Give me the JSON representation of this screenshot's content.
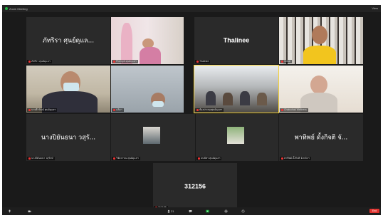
{
  "window": {
    "title": "Zoom Meeting",
    "view_label": "View"
  },
  "tiles": [
    {
      "name": "ภัทริรา ศุนย์ดุแล...",
      "label": "ภัทริรา ศุนย์ดุแลฯ"
    },
    {
      "name": "",
      "label": "Ploenpit ศุนย์ดุแลฯ"
    },
    {
      "name": "Thalinee",
      "label": "Thalinee"
    },
    {
      "name": "",
      "label": "Sebal"
    },
    {
      "name": "",
      "label": "นายธีรวัฒน์ ศุนย์ดุแลฯ"
    },
    {
      "name": "",
      "label": "ฉลิดา"
    },
    {
      "name": "",
      "label": "ห้องประชุมศุนย์ดุแลฯ"
    },
    {
      "name": "",
      "label": "Chatuchak Wellness"
    },
    {
      "name": "นางปิยันธนา วสุรั...",
      "label": "นางปิยันธนา วสุรักษ์"
    },
    {
      "name": "",
      "label": "วิชัยวรรณ ศุนย์ดุแลฯ"
    },
    {
      "name": "",
      "label": "ธนพัชร ศุนย์ดุแลฯ"
    },
    {
      "name": "พาทิพย์ ดั้งกิจติ จั...",
      "label": "พาทิพย์ ดั้งกิจติ จังหวัดฯ"
    },
    {
      "name": "312156",
      "label": "312156"
    }
  ],
  "bottombar": {
    "mute": "",
    "video": "",
    "participants_count": "21",
    "leave": "End"
  },
  "colors": {
    "active_border": "#f3d13b",
    "leave": "#e0332f",
    "share": "#1fb141"
  }
}
